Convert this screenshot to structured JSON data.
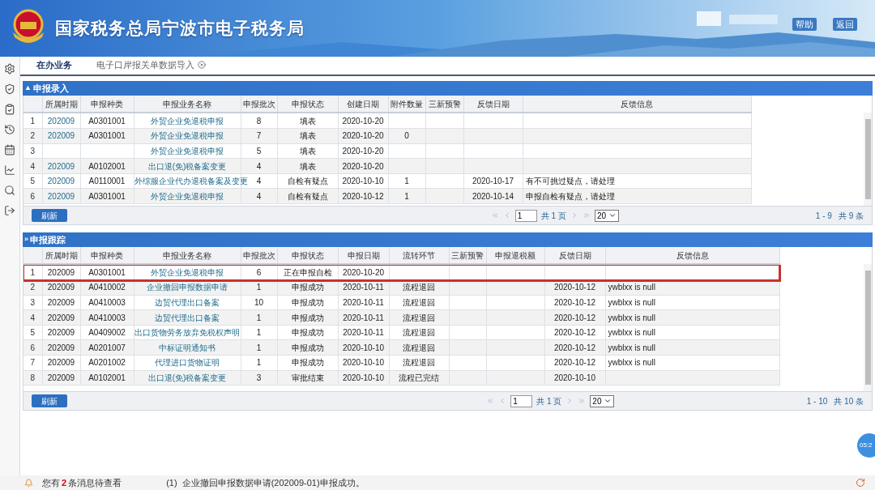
{
  "header": {
    "title": "国家税务总局宁波市电子税务局",
    "links": [
      "帮助",
      "返回"
    ]
  },
  "tabs": [
    {
      "label": "在办业务",
      "selected": true
    },
    {
      "label": "电子口岸报关单数据导入",
      "selected": false
    }
  ],
  "panels": [
    {
      "title": "申报录入",
      "collapse_icon": "▲",
      "columns": [
        {
          "label": "所属时期",
          "link": true
        },
        {
          "label": "申报种类",
          "link": false
        },
        {
          "label": "申报业务名称",
          "link": true
        },
        {
          "label": "申报批次",
          "link": false
        },
        {
          "label": "申报状态",
          "link": false
        },
        {
          "label": "创建日期",
          "link": false
        },
        {
          "label": "附件数量",
          "link": false
        },
        {
          "label": "三新预警",
          "link": false
        },
        {
          "label": "反馈日期",
          "link": false
        },
        {
          "label": "反馈信息",
          "link": false
        }
      ],
      "rows": [
        {
          "index": "1",
          "highlighted": false,
          "cells": [
            "202009",
            "A0301001",
            "外贸企业免退税申报",
            "8",
            "填表",
            "2020-10-20",
            null,
            null,
            null,
            null
          ]
        },
        {
          "index": "2",
          "highlighted": false,
          "cells": [
            "202009",
            "A0301001",
            "外贸企业免退税申报",
            "7",
            "填表",
            "2020-10-20",
            "0",
            null,
            null,
            null
          ]
        },
        {
          "index": "3",
          "highlighted": false,
          "cells": [
            null,
            null,
            "外贸企业免退税申报",
            "5",
            "填表",
            "2020-10-20",
            null,
            null,
            null,
            null
          ]
        },
        {
          "index": "4",
          "highlighted": false,
          "cells": [
            "202009",
            "A0102001",
            "出口退(免)税备案变更",
            "4",
            "填表",
            "2020-10-20",
            null,
            null,
            null,
            null
          ]
        },
        {
          "index": "5",
          "highlighted": false,
          "cells": [
            "202009",
            "A0110001",
            "外综服企业代办退税备案及变更",
            "4",
            "自检有疑点",
            "2020-10-10",
            "1",
            null,
            "2020-10-17",
            "有不可挑过疑点，请处理"
          ]
        },
        {
          "index": "6",
          "highlighted": false,
          "cells": [
            "202009",
            "A0301001",
            "外贸企业免退税申报",
            "4",
            "自检有疑点",
            "2020-10-12",
            "1",
            null,
            "2020-10-14",
            "申报自检有疑点，请处理"
          ]
        }
      ],
      "refresh": "刷新",
      "page": "1",
      "page_total": "共 1 页",
      "page_size": "20",
      "range": "1 - 9",
      "count": "共 9 条"
    },
    {
      "title": "申报跟踪",
      "collapse_icon": "»",
      "columns": [
        {
          "label": "所属时期",
          "link": false
        },
        {
          "label": "申报种类",
          "link": false
        },
        {
          "label": "申报业务名称",
          "link": true
        },
        {
          "label": "申报批次",
          "link": false
        },
        {
          "label": "申报状态",
          "link": false
        },
        {
          "label": "申报日期",
          "link": false
        },
        {
          "label": "流转环节",
          "link": false
        },
        {
          "label": "三新预警",
          "link": false
        },
        {
          "label": "申报退税额",
          "link": false
        },
        {
          "label": "反馈日期",
          "link": false
        },
        {
          "label": "反馈信息",
          "link": false
        }
      ],
      "rows": [
        {
          "index": "1",
          "highlighted": true,
          "cells": [
            "202009",
            "A0301001",
            "外贸企业免退税申报",
            "6",
            "正在申报自检",
            "2020-10-20",
            null,
            null,
            null,
            null,
            null
          ]
        },
        {
          "index": "2",
          "highlighted": false,
          "cells": [
            "202009",
            "A0410002",
            "企业撤回申报数据申请",
            "1",
            "申报成功",
            "2020-10-11",
            "流程退回",
            null,
            null,
            "2020-10-12",
            "ywblxx is null"
          ]
        },
        {
          "index": "3",
          "highlighted": false,
          "cells": [
            "202009",
            "A0410003",
            "边贸代理出口备案",
            "10",
            "申报成功",
            "2020-10-11",
            "流程退回",
            null,
            null,
            "2020-10-12",
            "ywblxx is null"
          ]
        },
        {
          "index": "4",
          "highlighted": false,
          "cells": [
            "202009",
            "A0410003",
            "边贸代理出口备案",
            "1",
            "申报成功",
            "2020-10-11",
            "流程退回",
            null,
            null,
            "2020-10-12",
            "ywblxx is null"
          ]
        },
        {
          "index": "5",
          "highlighted": false,
          "cells": [
            "202009",
            "A0409002",
            "出口货物劳务放弃免税权声明",
            "1",
            "申报成功",
            "2020-10-11",
            "流程退回",
            null,
            null,
            "2020-10-12",
            "ywblxx is null"
          ]
        },
        {
          "index": "6",
          "highlighted": false,
          "cells": [
            "202009",
            "A0201007",
            "中标证明通知书",
            "1",
            "申报成功",
            "2020-10-10",
            "流程退回",
            null,
            null,
            "2020-10-12",
            "ywblxx is null"
          ]
        },
        {
          "index": "7",
          "highlighted": false,
          "cells": [
            "202009",
            "A0201002",
            "代理进口货物证明",
            "1",
            "申报成功",
            "2020-10-10",
            "流程退回",
            null,
            null,
            "2020-10-12",
            "ywblxx is null"
          ]
        },
        {
          "index": "8",
          "highlighted": false,
          "cells": [
            "202009",
            "A0102001",
            "出口退(免)税备案变更",
            "3",
            "审批结束",
            "2020-10-10",
            "流程已完结",
            null,
            null,
            "2020-10-10",
            null
          ]
        }
      ],
      "refresh": "刷新",
      "page": "1",
      "page_total": "共 1 页",
      "page_size": "20",
      "range": "1 - 10",
      "count": "共 10 条"
    }
  ],
  "timer_badge": "05:2",
  "status_bar": {
    "message_prefix": "您有",
    "message_count": "2",
    "message_suffix": "条消息待查看",
    "notice": "(1)  企业撤回申报数据申请(202009-01)申报成功。"
  }
}
